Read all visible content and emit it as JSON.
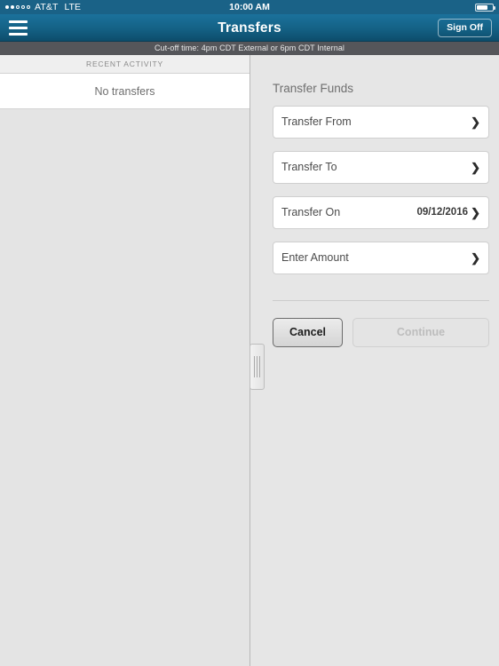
{
  "status_bar": {
    "signal_dots_total": 5,
    "signal_dots_filled": 2,
    "carrier": "AT&T",
    "network": "LTE",
    "time": "10:00 AM",
    "battery_percent": 62
  },
  "nav_bar": {
    "menu_icon": "hamburger-menu-icon",
    "title": "Transfers",
    "sign_off_label": "Sign Off"
  },
  "cutoff_banner": {
    "text": "Cut-off time: 4pm CDT External or 6pm CDT Internal"
  },
  "left_panel": {
    "section_header": "RECENT ACTIVITY",
    "empty_message": "No transfers"
  },
  "right_panel": {
    "form_title": "Transfer Funds",
    "fields": [
      {
        "label": "Transfer From",
        "value": "",
        "chevron": "❯"
      },
      {
        "label": "Transfer To",
        "value": "",
        "chevron": "❯"
      },
      {
        "label": "Transfer On",
        "value": "09/12/2016",
        "chevron": "❯"
      },
      {
        "label": "Enter Amount",
        "value": "",
        "chevron": "❯"
      }
    ],
    "buttons": {
      "cancel_label": "Cancel",
      "continue_label": "Continue"
    }
  },
  "colors": {
    "nav_blue_top": "#1b729c",
    "nav_blue_bottom": "#0d4d6b",
    "status_blue": "#1a6287",
    "cutoff_gray": "#55565a",
    "panel_gray": "#e6e6e6",
    "field_white": "#ffffff"
  }
}
